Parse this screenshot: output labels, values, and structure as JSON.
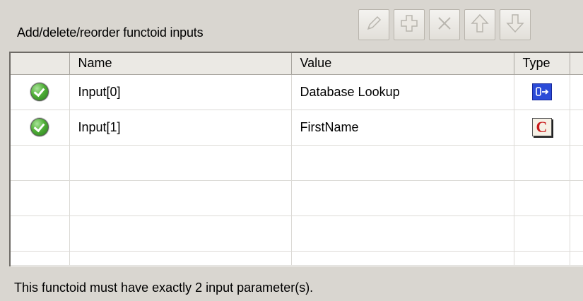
{
  "header": {
    "label": "Add/delete/reorder functoid inputs"
  },
  "toolbar": {
    "buttons": [
      {
        "name": "edit-button",
        "icon": "pencil-icon"
      },
      {
        "name": "add-button",
        "icon": "plus-icon"
      },
      {
        "name": "delete-button",
        "icon": "x-icon"
      },
      {
        "name": "move-up-button",
        "icon": "arrow-up-icon"
      },
      {
        "name": "move-down-button",
        "icon": "arrow-down-icon"
      }
    ]
  },
  "grid": {
    "columns": [
      "",
      "Name",
      "Value",
      "Type",
      ""
    ],
    "rows": [
      {
        "status_icon": "check-icon",
        "name": "Input[0]",
        "value": "Database Lookup",
        "type_icon": "database-link-icon"
      },
      {
        "status_icon": "check-icon",
        "name": "Input[1]",
        "value": "FirstName",
        "type_icon": "constant-icon"
      }
    ],
    "type_icon_glyphs": {
      "constant": "C"
    }
  },
  "footer": {
    "message": "This functoid must have exactly 2 input parameter(s)."
  },
  "colors": {
    "check_green": "#4fae36",
    "db_icon_blue": "#2b4bd8",
    "const_icon_red": "#c81818"
  }
}
